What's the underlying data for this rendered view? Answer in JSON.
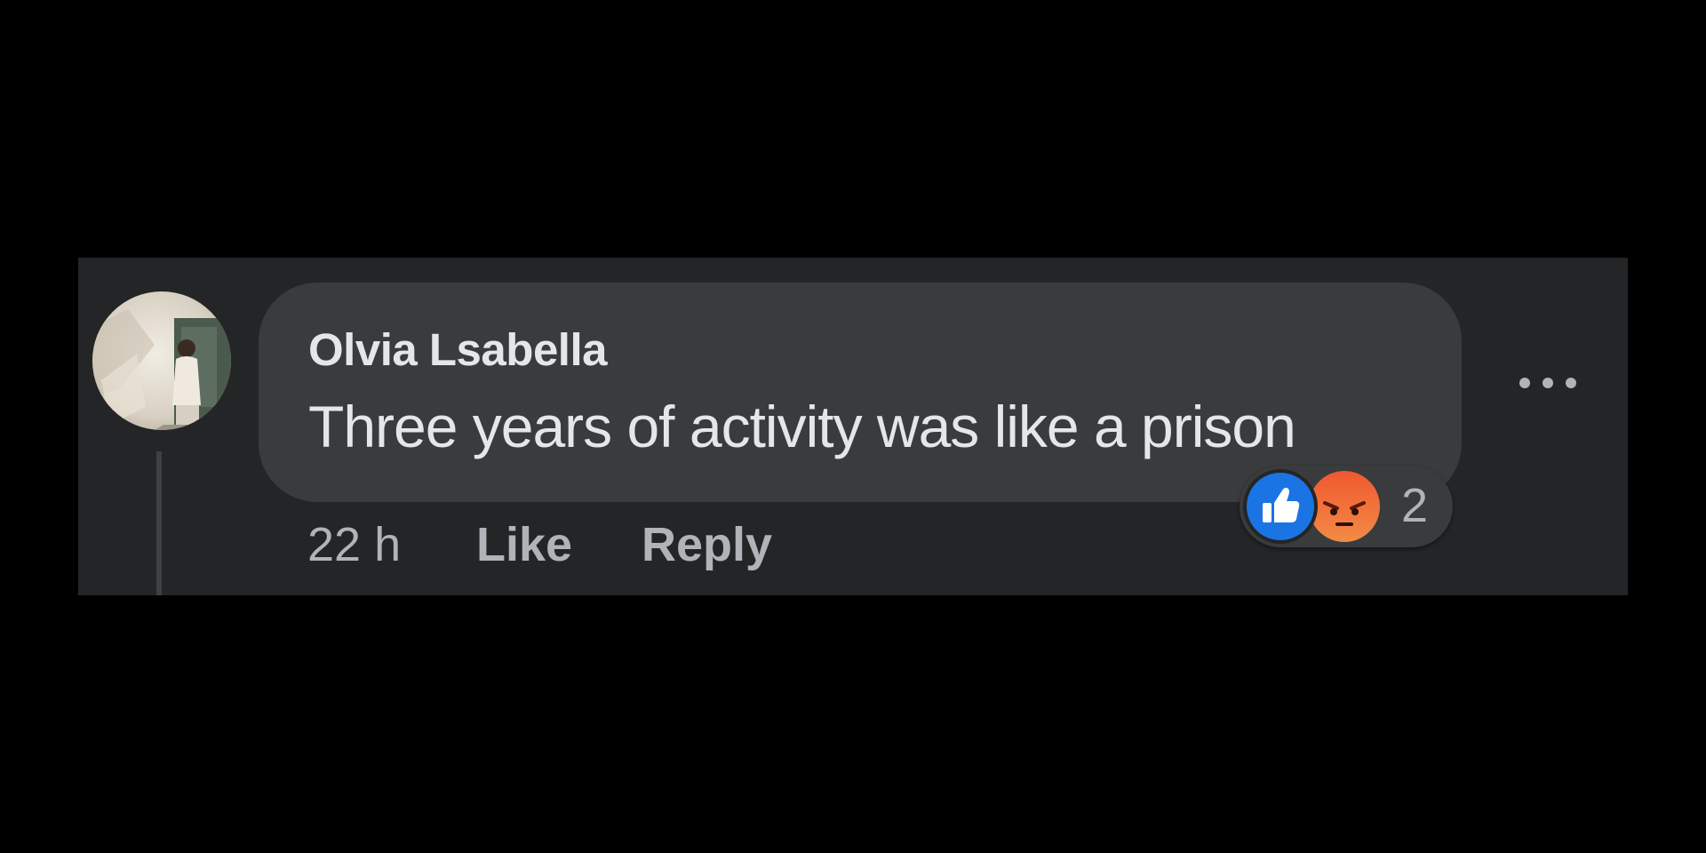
{
  "comment": {
    "author": "Olvia Lsabella",
    "text": "Three years of activity was like a prison",
    "timestamp": "22 h",
    "like_label": "Like",
    "reply_label": "Reply",
    "avatar_icon": "profile-photo-avatar",
    "more_icon": "more-options-icon"
  },
  "reactions": {
    "types": [
      "like",
      "angry"
    ],
    "count": "2",
    "like_color": "#1877f2",
    "angry_color": "#e9710f"
  },
  "colors": {
    "page_background": "#000000",
    "panel_background": "#242526",
    "bubble_background": "#3a3b3c",
    "primary_text": "#e4e6eb",
    "secondary_text": "#b0b3b8"
  }
}
